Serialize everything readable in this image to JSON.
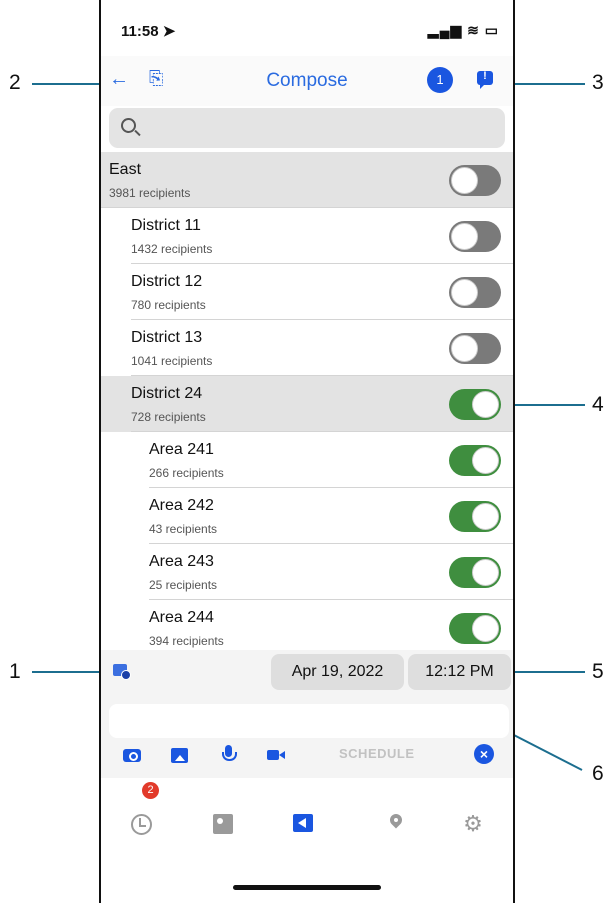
{
  "status_bar": {
    "time": "11:58 ➤",
    "indicators": "▂▄▆ ≋ ▭"
  },
  "navbar": {
    "back_icon": "←",
    "doc_icon": "⎘",
    "title": "Compose",
    "badge_count": "1"
  },
  "search": {
    "placeholder": ""
  },
  "list": {
    "rows": [
      {
        "name": "East",
        "recipients": "3981 recipients",
        "on": false,
        "level": 0,
        "highlight": true
      },
      {
        "name": "District 11",
        "recipients": "1432 recipients",
        "on": false,
        "level": 1,
        "highlight": false
      },
      {
        "name": "District 12",
        "recipients": "780 recipients",
        "on": false,
        "level": 1,
        "highlight": false
      },
      {
        "name": "District 13",
        "recipients": "1041 recipients",
        "on": false,
        "level": 1,
        "highlight": false
      },
      {
        "name": "District 24",
        "recipients": "728 recipients",
        "on": true,
        "level": 1,
        "highlight": true
      },
      {
        "name": "Area 241",
        "recipients": "266 recipients",
        "on": true,
        "level": 2,
        "highlight": false
      },
      {
        "name": "Area 242",
        "recipients": "43 recipients",
        "on": true,
        "level": 2,
        "highlight": false
      },
      {
        "name": "Area 243",
        "recipients": "25 recipients",
        "on": true,
        "level": 2,
        "highlight": false
      },
      {
        "name": "Area 244",
        "recipients": "394 recipients",
        "on": true,
        "level": 2,
        "highlight": false
      }
    ]
  },
  "schedule": {
    "date": "Apr 19, 2022",
    "time": "12:12 PM"
  },
  "composer": {
    "message_placeholder": "",
    "schedule_label": "SCHEDULE",
    "cancel_glyph": "×"
  },
  "tabbar": {
    "history_badge": "2",
    "settings_glyph": "⚙"
  },
  "callouts": {
    "c1": "1",
    "c2": "2",
    "c3": "3",
    "c4": "4",
    "c5": "5",
    "c6": "6"
  },
  "colors": {
    "accent": "#1a56e0",
    "toggle_on": "#3f8e3f",
    "toggle_off": "#7a7a7a",
    "badge_red": "#e23a2a",
    "callout_line": "#1c6e8f"
  }
}
